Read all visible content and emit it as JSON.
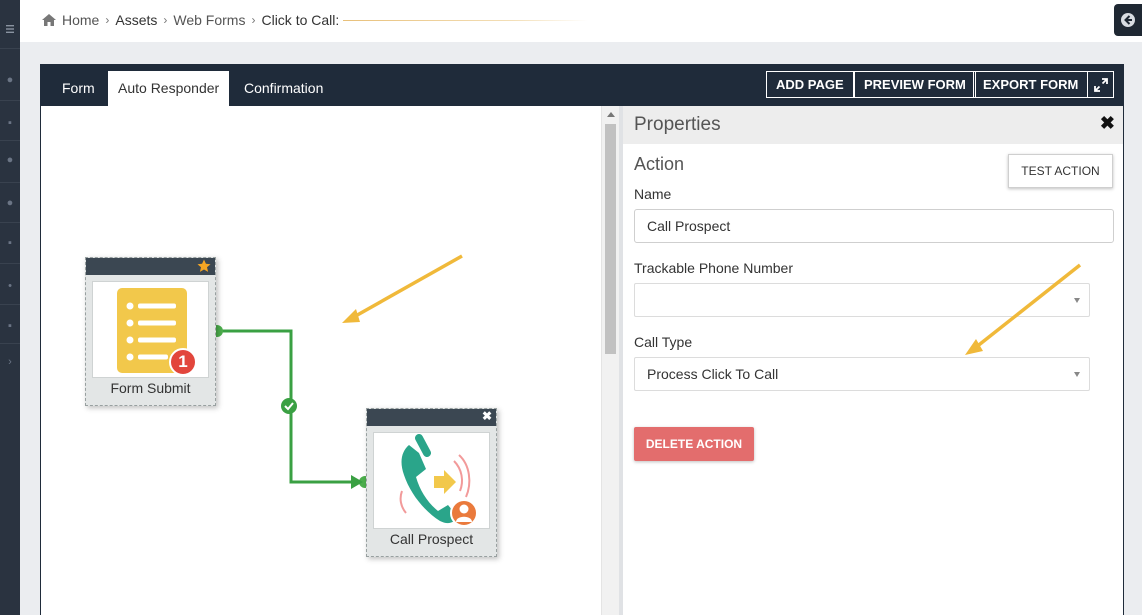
{
  "sidebar": {
    "icons": [
      "menu-icon",
      "dashboard-icon",
      "lock-icon",
      "users-icon",
      "settings-icon",
      "layers-icon",
      "bell-icon",
      "mobile-icon",
      "expand-icon"
    ]
  },
  "breadcrumb": {
    "home": "Home",
    "assets": "Assets",
    "web_forms": "Web Forms",
    "current": "Click to Call:"
  },
  "tabs": [
    {
      "label": "Form",
      "active": false
    },
    {
      "label": "Auto Responder",
      "active": true
    },
    {
      "label": "Confirmation",
      "active": false
    }
  ],
  "header_buttons": {
    "add_page": "ADD PAGE",
    "preview_form": "PREVIEW FORM",
    "export_form": "EXPORT FORM",
    "fullscreen_icon": "expand-arrows-icon"
  },
  "canvas": {
    "nodes": [
      {
        "label": "Form Submit",
        "icon": "form-list-icon",
        "badge": "1",
        "header_icon": "star-icon"
      },
      {
        "label": "Call Prospect",
        "icon": "phone-call-icon",
        "header_icon": "close-icon"
      }
    ]
  },
  "properties": {
    "title": "Properties",
    "close": "✖",
    "section": "Action",
    "test_action": "TEST ACTION",
    "name_label": "Name",
    "name_value": "Call Prospect",
    "phone_label": "Trackable Phone Number",
    "phone_value": "",
    "call_type_label": "Call Type",
    "call_type_value": "Process Click To Call",
    "delete_action": "DELETE ACTION"
  },
  "colors": {
    "header_dark": "#1f2b3a",
    "connector_green": "#3aa043",
    "delete_red": "#e36d6d",
    "form_icon_yellow": "#f2c84b",
    "phone_teal": "#2aa58a",
    "annotation_arrow": "#f0b93a"
  }
}
